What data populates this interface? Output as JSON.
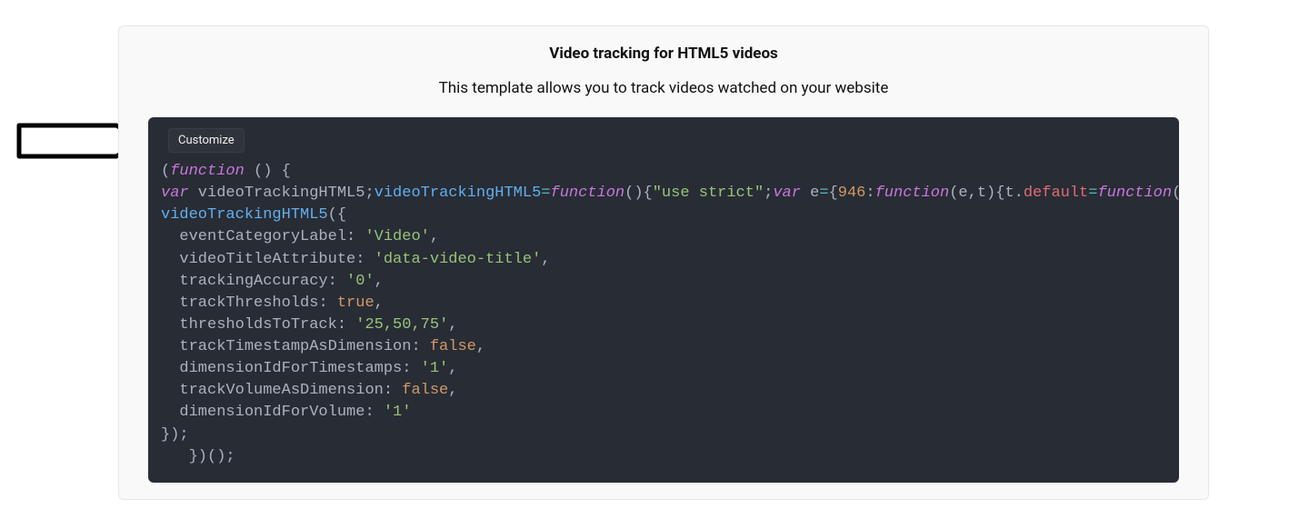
{
  "card": {
    "title": "Video tracking for HTML5 videos",
    "subtitle": "This template allows you to track videos watched on your website",
    "customize_label": "Customize"
  },
  "code": {
    "l1": {
      "open_paren": "(",
      "kw_function": "function",
      "sig": " () {"
    },
    "l2": {
      "kw_var1": "var",
      "decl": " videoTrackingHTML5;",
      "assign_name": "videoTrackingHTML5",
      "eq": "=",
      "kw_function": "function",
      "call": "(){",
      "str_use_strict": "\"use strict\"",
      "semi": ";",
      "kw_var2": "var",
      "e_eq": " e",
      "eq2": "=",
      "brace": "{",
      "num946": "946",
      "colon": ":",
      "kw_function2": "function",
      "params": "(e,t){",
      "t": "t",
      "dot": ".",
      "default_kw": "default",
      "eq3": "=",
      "kw_function3": "function",
      "trail": "("
    },
    "l3": {
      "call_name": "videoTrackingHTML5",
      "open": "({"
    },
    "l4": {
      "indent": "  ",
      "prop": "eventCategoryLabel",
      "colon": ": ",
      "val": "'Video'",
      "comma": ","
    },
    "l5": {
      "indent": "  ",
      "prop": "videoTitleAttribute",
      "colon": ": ",
      "val": "'data-video-title'",
      "comma": ","
    },
    "l6": {
      "indent": "  ",
      "prop": "trackingAccuracy",
      "colon": ": ",
      "val": "'0'",
      "comma": ","
    },
    "l7": {
      "indent": "  ",
      "prop": "trackThresholds",
      "colon": ": ",
      "val": "true",
      "comma": ","
    },
    "l8": {
      "indent": "  ",
      "prop": "thresholdsToTrack",
      "colon": ": ",
      "val": "'25,50,75'",
      "comma": ","
    },
    "l9": {
      "indent": "  ",
      "prop": "trackTimestampAsDimension",
      "colon": ": ",
      "val": "false",
      "comma": ","
    },
    "l10": {
      "indent": "  ",
      "prop": "dimensionIdForTimestamps",
      "colon": ": ",
      "val": "'1'",
      "comma": ","
    },
    "l11": {
      "indent": "  ",
      "prop": "trackVolumeAsDimension",
      "colon": ": ",
      "val": "false",
      "comma": ","
    },
    "l12": {
      "indent": "  ",
      "prop": "dimensionIdForVolume",
      "colon": ": ",
      "val": "'1'"
    },
    "l13": {
      "text": "});"
    },
    "l14": {
      "text": "   })();"
    }
  }
}
